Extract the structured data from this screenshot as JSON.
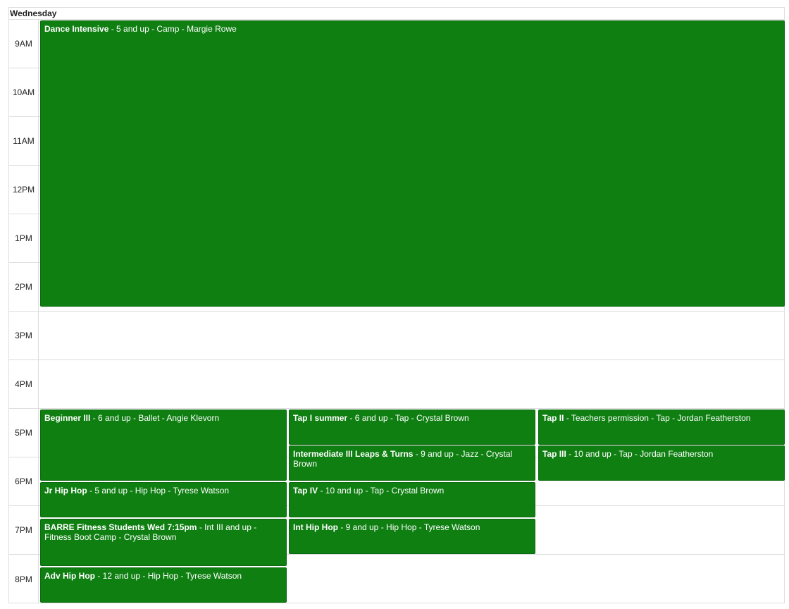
{
  "day": "Wednesday",
  "colors": {
    "event_bg": "#0f7f12",
    "grid_line": "#dddddd"
  },
  "times": [
    "9AM",
    "10AM",
    "11AM",
    "12PM",
    "1PM",
    "2PM",
    "3PM",
    "4PM",
    "5PM",
    "6PM",
    "7PM",
    "8PM"
  ],
  "events": [
    {
      "title": "Dance Intensive",
      "details": " - 5 and up - Camp - Margie Rowe"
    },
    {
      "title": "Beginner III",
      "details": " - 6 and up - Ballet - Angie Klevorn"
    },
    {
      "title": "Tap I summer",
      "details": " - 6 and up - Tap - Crystal Brown"
    },
    {
      "title": "Tap II",
      "details": " - Teachers permission - Tap - Jordan Featherston"
    },
    {
      "title": "Intermediate III Leaps & Turns",
      "details": " - 9 and up - Jazz - Crystal Brown"
    },
    {
      "title": "Tap III",
      "details": " - 10 and up - Tap - Jordan Featherston"
    },
    {
      "title": "Jr Hip Hop",
      "details": " - 5 and up - Hip Hop - Tyrese Watson"
    },
    {
      "title": "Tap IV",
      "details": " - 10 and up - Tap - Crystal Brown"
    },
    {
      "title": "BARRE Fitness Students Wed 7:15pm",
      "details": " - Int III and up - Fitness Boot Camp - Crystal Brown"
    },
    {
      "title": "Int Hip Hop",
      "details": " - 9 and up - Hip Hop - Tyrese Watson"
    },
    {
      "title": "Adv Hip Hop",
      "details": " - 12 and up - Hip Hop - Tyrese Watson"
    }
  ]
}
